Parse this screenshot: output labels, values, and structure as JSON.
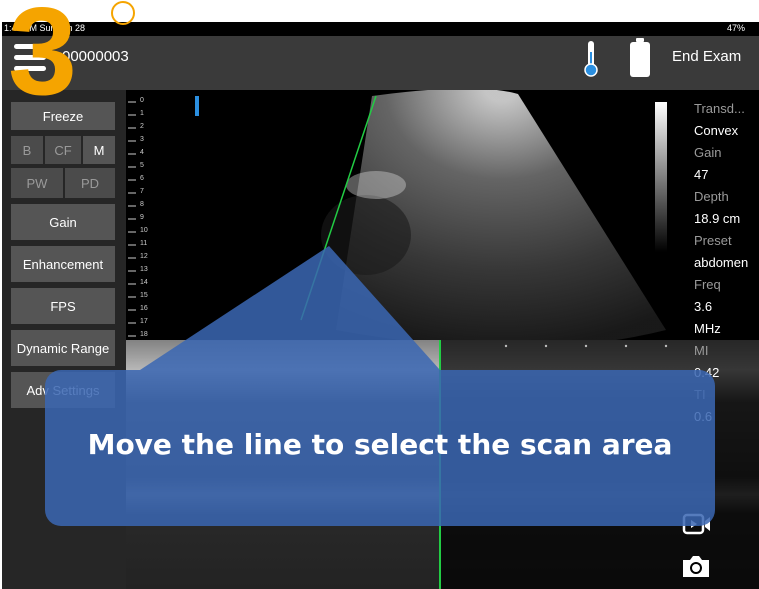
{
  "status": {
    "time": "1:48 AM  Sun Jun 28",
    "battery": "47%"
  },
  "header": {
    "exam_id": "00000003",
    "end_exam": "End Exam"
  },
  "tutorial": {
    "step": "3",
    "instruction": "Move the line to select the scan area"
  },
  "sidebar": {
    "freeze": "Freeze",
    "modes": [
      "B",
      "CF",
      "M"
    ],
    "modes2": [
      "PW",
      "PD"
    ],
    "gain": "Gain",
    "enhancement": "Enhancement",
    "fps": "FPS",
    "dynamic_range": "Dynamic Range",
    "adv_settings": "Adv Settings"
  },
  "ruler_ticks": [
    "0",
    "1",
    "2",
    "3",
    "4",
    "5",
    "6",
    "7",
    "8",
    "9",
    "10",
    "11",
    "12",
    "13",
    "14",
    "15",
    "16",
    "17",
    "18"
  ],
  "params": [
    {
      "label": "Transd...",
      "value": "Convex"
    },
    {
      "label": "Gain",
      "value": "47"
    },
    {
      "label": "Depth",
      "value": "18.9 cm"
    },
    {
      "label": "Preset",
      "value": "abdomen"
    },
    {
      "label": "Freq",
      "value": "3.6"
    },
    {
      "label": "",
      "value": "MHz"
    },
    {
      "label": "MI",
      "value": "0.42"
    },
    {
      "label": "TI",
      "value": "0.6"
    }
  ],
  "colors": {
    "accent": "#f5a400",
    "overlay": "#3a67b2",
    "mline": "#22cc44"
  },
  "icons": {
    "menu": "hamburger-menu-icon",
    "thermo": "thermometer-icon",
    "battery": "battery-icon",
    "video": "video-record-icon",
    "camera": "camera-icon"
  }
}
